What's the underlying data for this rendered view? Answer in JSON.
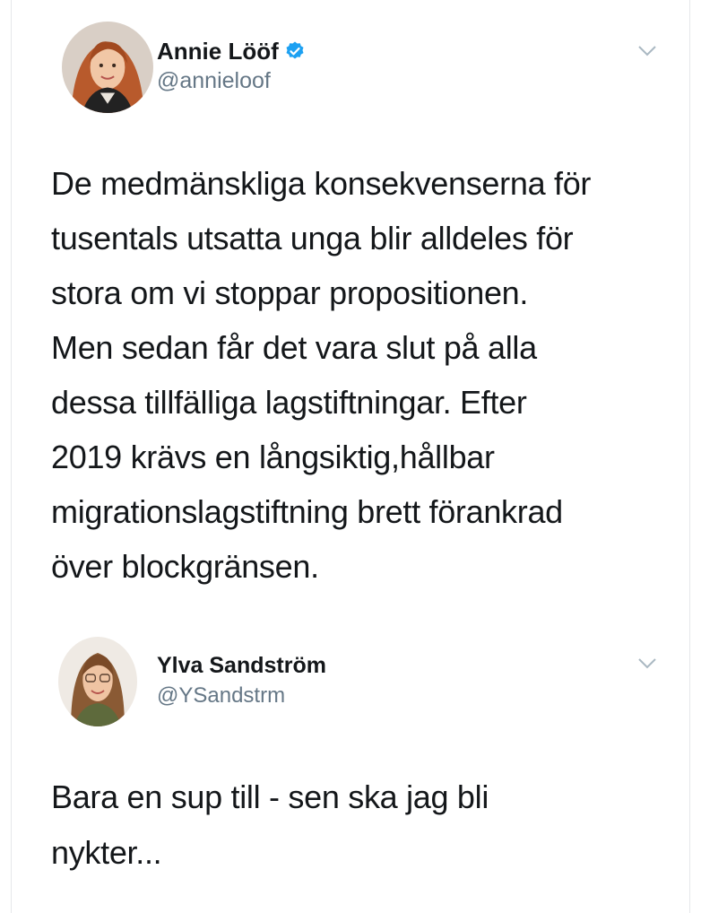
{
  "tweets": [
    {
      "name": "Annie Lööf",
      "handle": "@annieloof",
      "verified": true,
      "text": "De medmänskliga konsekvenserna för\ntusentals utsatta unga blir alldeles för\nstora om vi stoppar propositionen.\nMen sedan får det vara slut på alla\ndessa tillfälliga lagstiftningar. Efter\n2019 krävs en långsiktig,hållbar\nmigrationslagstiftning brett förankrad\növer blockgränsen."
    },
    {
      "name": "Ylva Sandström",
      "handle": "@YSandstrm",
      "verified": false,
      "text": "Bara en sup till - sen ska jag bli\nnykter..."
    }
  ],
  "colors": {
    "verified": "#1da1f2",
    "handle": "#657786",
    "text": "#14171a",
    "chevron": "#aab8c2"
  },
  "icons": {
    "verified": "verified-badge-icon",
    "menu": "chevron-down-icon"
  }
}
